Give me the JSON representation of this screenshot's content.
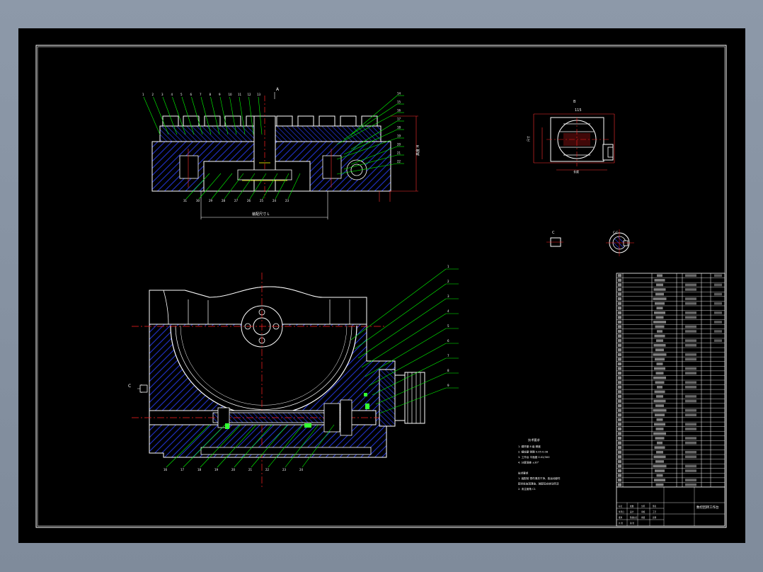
{
  "drawing": {
    "background": "#000000",
    "colors": {
      "outline": "#ffffff",
      "leader": "#00ff00",
      "centerline": "#ff2020",
      "hatch": "#2233cc",
      "dimension": "#ff3030",
      "accent": "#ffff00",
      "highlight": "#33ff33"
    },
    "section_view": {
      "section_mark": "A",
      "callouts_top": [
        "1",
        "2",
        "3",
        "4",
        "5",
        "6",
        "7",
        "8",
        "9",
        "10",
        "11",
        "12",
        "13"
      ],
      "callouts_right": [
        "14",
        "15",
        "16",
        "17",
        "18",
        "19",
        "20",
        "21",
        "22"
      ],
      "callouts_bottom": [
        "31",
        "30",
        "29",
        "28",
        "27",
        "26",
        "25",
        "24",
        "23"
      ]
    },
    "aux_view": {
      "label": "B"
    },
    "detail_view": {
      "label": "C",
      "section_label": "C-C"
    },
    "main_view": {
      "view_label": "C",
      "callouts_right": [
        "1",
        "2",
        "3",
        "4",
        "5",
        "6",
        "7",
        "8",
        "9"
      ],
      "callouts_bottom": [
        "16",
        "17",
        "18",
        "19",
        "20",
        "21",
        "22",
        "23",
        "24"
      ]
    },
    "tech_requirements": {
      "title": "技术要求",
      "lines": [
        "1. 蜗杆副 8 级 精度",
        "2. 蜗轮副 侧隙 0.05-0.08",
        "3. 工作台 平面度 0.02/300",
        "4. 分度误差 ±30\"",
        "",
        "技术要求",
        "1. 装配前 零件清洗干净，各运动部件",
        "   配合处加润滑油，装配后应转动灵活",
        "2. 未注倒角 C1"
      ]
    },
    "title_block": {
      "title": "数控回转工作台",
      "labels": [
        "标记",
        "处数",
        "分区",
        "签名",
        "年月日",
        "设计",
        "审核",
        "工艺",
        "批准",
        "阶段标记",
        "重量",
        "比例",
        "共 张",
        "第 张"
      ]
    },
    "bom": {
      "row_count": 46
    }
  }
}
